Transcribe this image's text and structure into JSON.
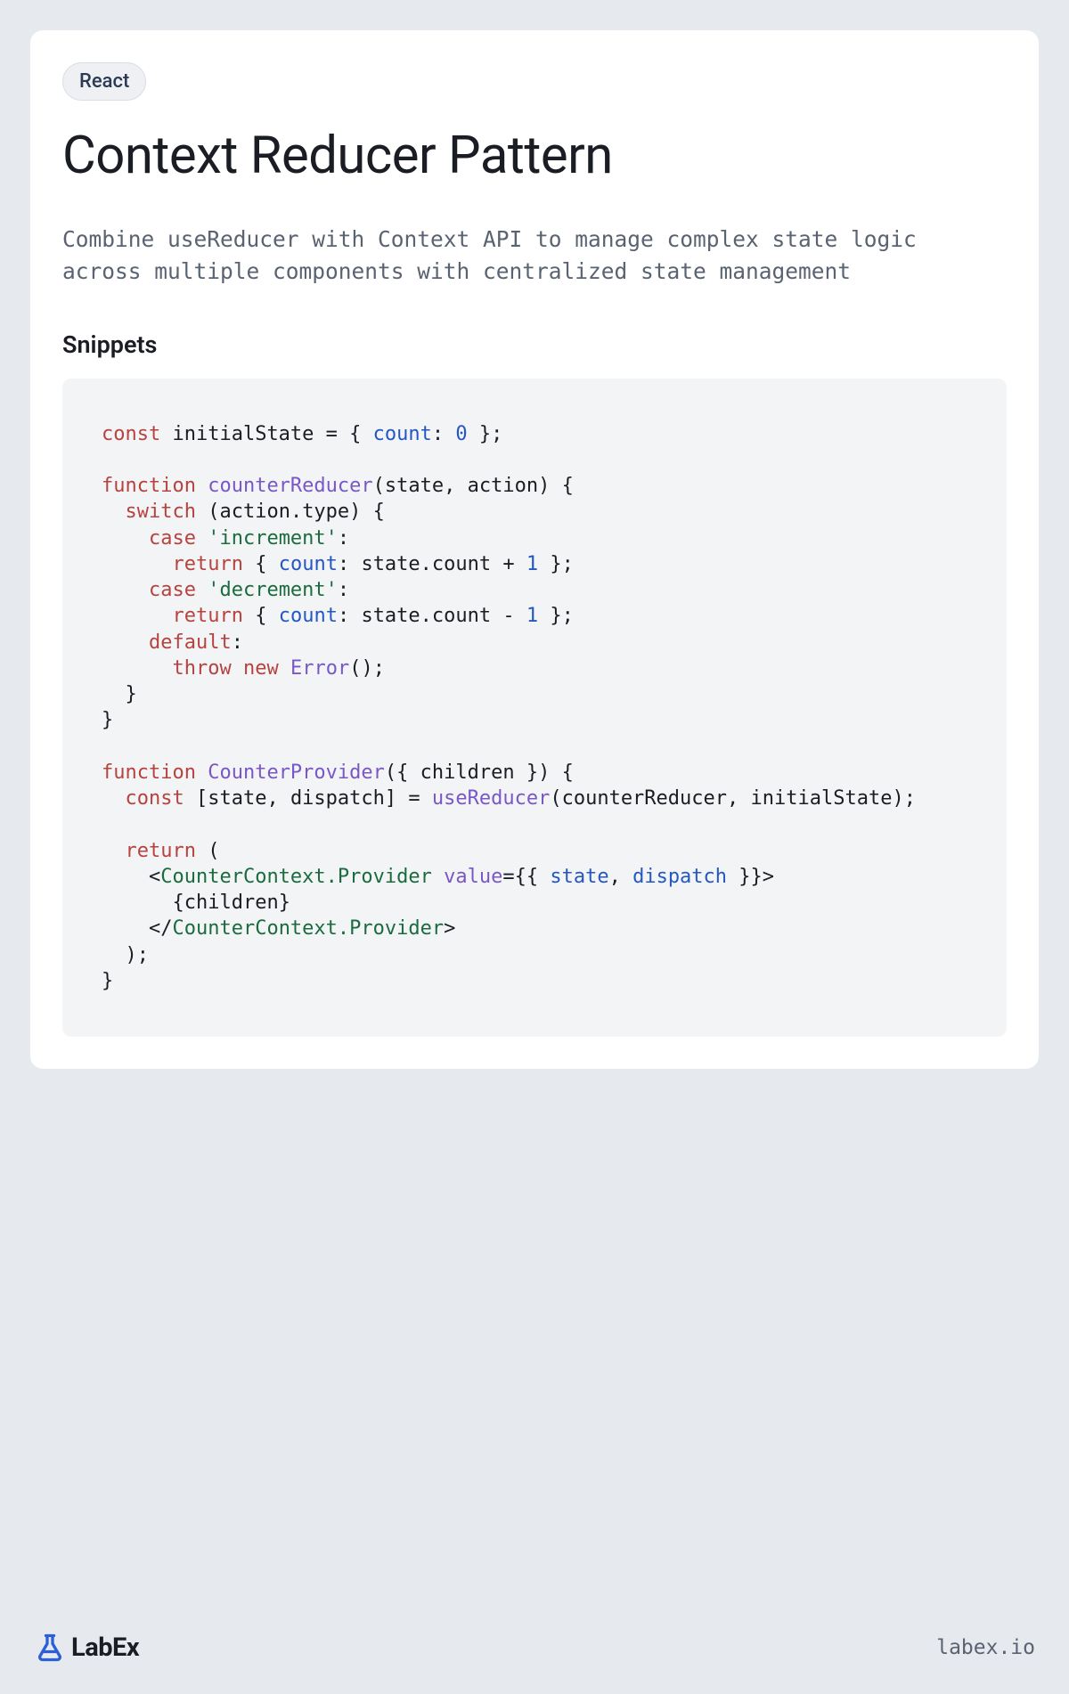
{
  "badge": "React",
  "title": "Context Reducer Pattern",
  "description": "Combine useReducer with Context API to manage complex state logic across multiple components with centralized state management",
  "snippets_heading": "Snippets",
  "code": {
    "l1_kw": "const",
    "l1_rest": " initialState = { ",
    "l1_attr": "count",
    "l1_colon": ": ",
    "l1_num": "0",
    "l1_end": " };",
    "l3_kw": "function",
    "l3_sp": " ",
    "l3_fn": "counterReducer",
    "l3_rest": "(state, action) {",
    "l4_indent": "  ",
    "l4_kw": "switch",
    "l4_rest": " (action.type) {",
    "l5_indent": "    ",
    "l5_kw": "case",
    "l5_sp": " ",
    "l5_str": "'increment'",
    "l5_colon": ":",
    "l6_indent": "      ",
    "l6_kw": "return",
    "l6_rest": " { ",
    "l6_attr": "count",
    "l6_mid": ": state.count + ",
    "l6_num": "1",
    "l6_end": " };",
    "l7_indent": "    ",
    "l7_kw": "case",
    "l7_sp": " ",
    "l7_str": "'decrement'",
    "l7_colon": ":",
    "l8_indent": "      ",
    "l8_kw": "return",
    "l8_rest": " { ",
    "l8_attr": "count",
    "l8_mid": ": state.count - ",
    "l8_num": "1",
    "l8_end": " };",
    "l9_indent": "    ",
    "l9_kw": "default",
    "l9_colon": ":",
    "l10_indent": "      ",
    "l10_kw1": "throw",
    "l10_sp": " ",
    "l10_kw2": "new",
    "l10_sp2": " ",
    "l10_err": "Error",
    "l10_end": "();",
    "l11": "  }",
    "l12": "}",
    "l14_kw": "function",
    "l14_sp": " ",
    "l14_fn": "CounterProvider",
    "l14_rest": "({ children }) {",
    "l15_indent": "  ",
    "l15_kw": "const",
    "l15_rest": " [state, dispatch] = ",
    "l15_call": "useReducer",
    "l15_end": "(counterReducer, initialState);",
    "l17_indent": "  ",
    "l17_kw": "return",
    "l17_rest": " (",
    "l18_indent": "    <",
    "l18_tag": "CounterContext.Provider",
    "l18_sp": " ",
    "l18_attrname": "value",
    "l18_eq": "={{ ",
    "l18_v1": "state",
    "l18_comma": ", ",
    "l18_v2": "dispatch",
    "l18_end": " }}>",
    "l19": "      {children}",
    "l20_indent": "    </",
    "l20_tag": "CounterContext.Provider",
    "l20_end": ">",
    "l21": "  );",
    "l22": "}"
  },
  "footer": {
    "brand": "LabEx",
    "url": "labex.io"
  }
}
